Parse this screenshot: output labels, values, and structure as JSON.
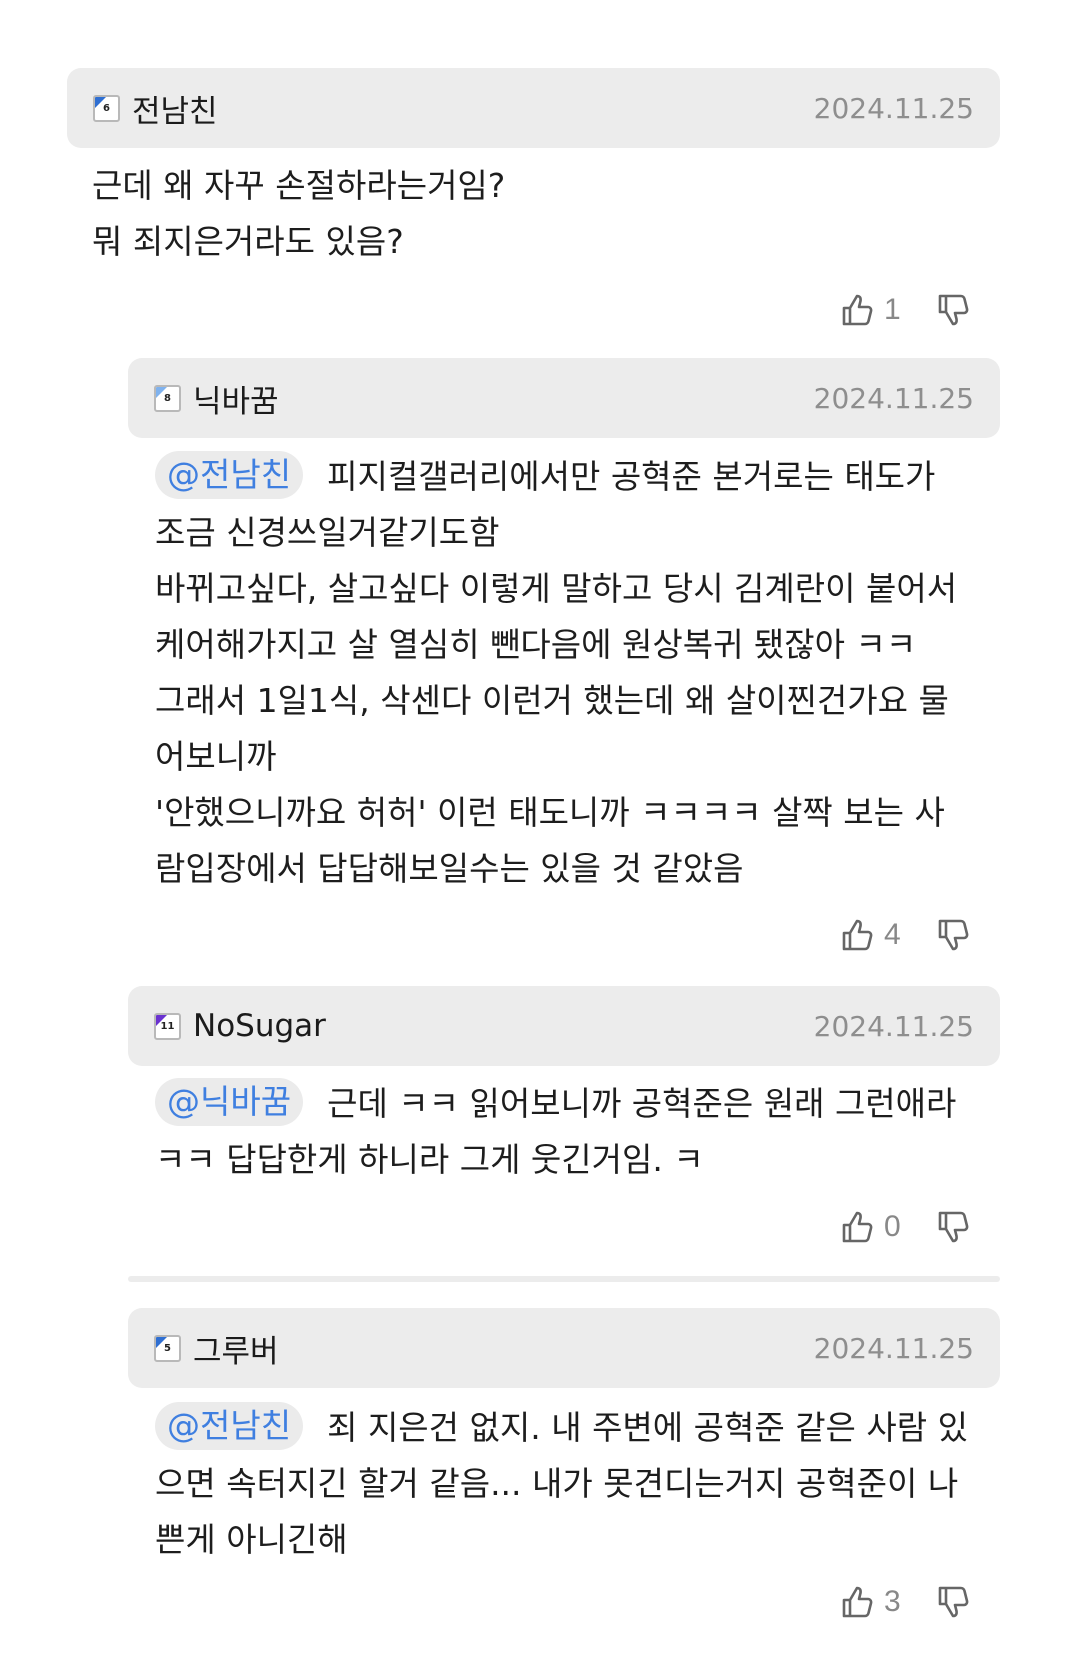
{
  "comments": [
    {
      "level": "6",
      "nickname": "전남친",
      "date": "2024.11.25",
      "mention": "",
      "lines": [
        "근데 왜 자꾸 손절하라는거임?",
        "뭐 죄지은거라도 있음?"
      ],
      "upvotes": "1",
      "downvotes": ""
    },
    {
      "level": "8",
      "nickname": "닉바꿈",
      "date": "2024.11.25",
      "mention": "@전남친",
      "lines": [
        "피지컬갤러리에서만 공혁준 본거로는 태도가",
        "조금 신경쓰일거같기도함",
        "바뀌고싶다, 살고싶다 이렇게 말하고 당시 김계란이 붙어서",
        "케어해가지고 살 열심히 뺀다음에 원상복귀 됐잖아 ㅋㅋ",
        "그래서 1일1식, 삭센다 이런거 했는데 왜 살이찐건가요 물",
        "어보니까",
        "'안했으니까요 허허' 이런 태도니까 ㅋㅋㅋㅋ 살짝 보는 사",
        "람입장에서 답답해보일수는 있을 것 같았음"
      ],
      "upvotes": "4",
      "downvotes": ""
    },
    {
      "level": "11",
      "nickname": "NoSugar",
      "date": "2024.11.25",
      "mention": "@닉바꿈",
      "lines": [
        "근데 ㅋㅋ 읽어보니까 공혁준은 원래 그런애라",
        "ㅋㅋ 답답한게 하니라 그게 웃긴거임. ㅋ"
      ],
      "upvotes": "0",
      "downvotes": ""
    },
    {
      "level": "5",
      "nickname": "그루버",
      "date": "2024.11.25",
      "mention": "@전남친",
      "lines": [
        "죄 지은건 없지. 내 주변에 공혁준 같은 사람 있",
        "으면 속터지긴 할거 같음... 내가 못견디는거지 공혁준이 나",
        "쁜게 아니긴해"
      ],
      "upvotes": "3",
      "downvotes": ""
    }
  ],
  "colors": {
    "header_bg": "#ececec",
    "mention_text": "#3f7fe0",
    "date_text": "#8e8e8e",
    "level_blue": "#2f6fd2",
    "level_purple": "#6a32d0"
  },
  "icons": {
    "upvote": "thumbs-up-icon",
    "downvote": "thumbs-down-icon"
  }
}
